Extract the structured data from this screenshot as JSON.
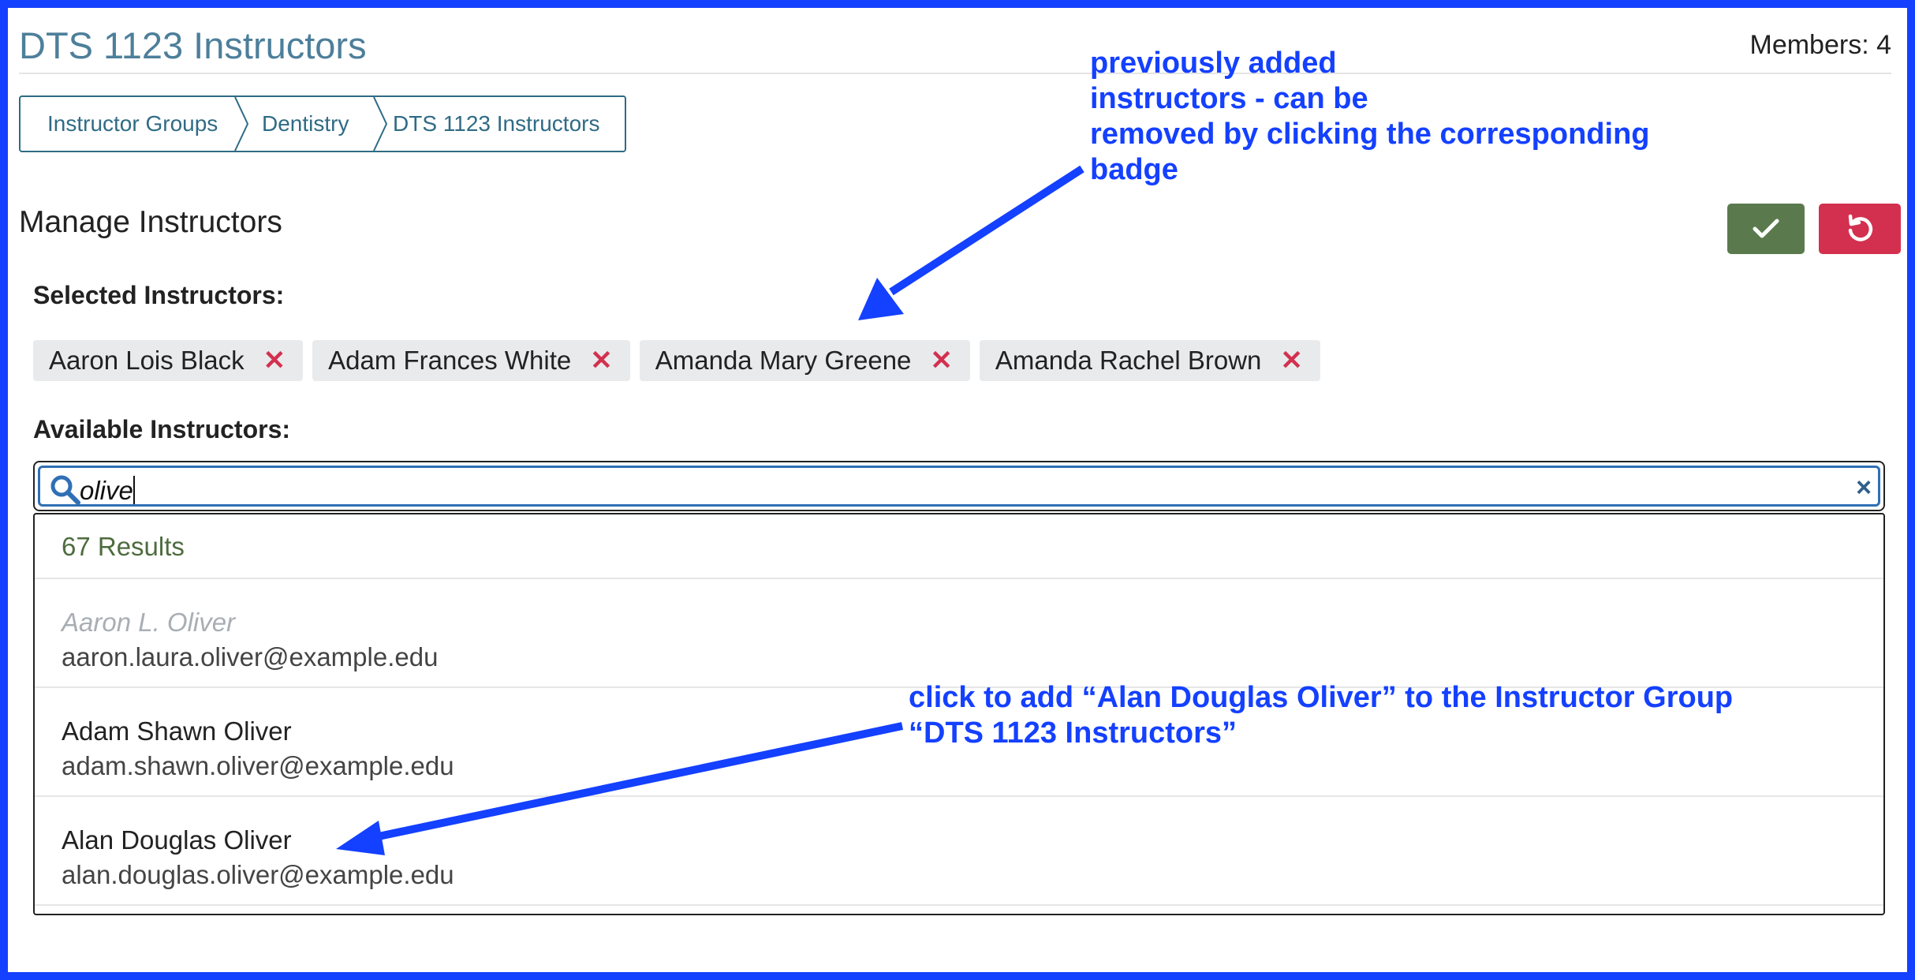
{
  "page": {
    "title": "DTS 1123 Instructors",
    "members": "Members: 4"
  },
  "breadcrumb": {
    "items": [
      {
        "label": "Instructor Groups"
      },
      {
        "label": "Dentistry"
      },
      {
        "label": "DTS 1123 Instructors"
      }
    ]
  },
  "manage": {
    "title": "Manage Instructors",
    "save_icon": "check-icon",
    "cancel_icon": "undo-icon"
  },
  "selected": {
    "label": "Selected Instructors:",
    "badges": [
      {
        "name": "Aaron Lois Black",
        "remove": "✕"
      },
      {
        "name": "Adam Frances White",
        "remove": "✕"
      },
      {
        "name": "Amanda Mary Greene",
        "remove": "✕"
      },
      {
        "name": "Amanda Rachel Brown",
        "remove": "✕"
      }
    ]
  },
  "available": {
    "label": "Available Instructors:",
    "search_value": "olive",
    "clear": "×"
  },
  "results": {
    "count": "67 Results",
    "items": [
      {
        "name": "Aaron L. Oliver",
        "email": "aaron.laura.oliver@example.edu",
        "disabled": true
      },
      {
        "name": "Adam Shawn Oliver",
        "email": "adam.shawn.oliver@example.edu",
        "disabled": false
      },
      {
        "name": "Alan Douglas Oliver",
        "email": "alan.douglas.oliver@example.edu",
        "disabled": false
      }
    ]
  },
  "annotations": {
    "top": [
      "previously added",
      "instructors - can be",
      "removed by clicking the corresponding",
      "badge"
    ],
    "bottom": [
      "click to add “Alan Douglas Oliver” to the Instructor Group",
      "“DTS 1123 Instructors”"
    ]
  },
  "colors": {
    "frame": "#1440ff",
    "title": "#4d7f9a",
    "save": "#5a7a4e",
    "cancel": "#d3304f",
    "annotation": "#1440ff"
  }
}
